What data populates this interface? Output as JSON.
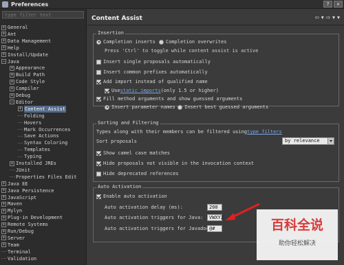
{
  "window": {
    "title": "Preferences"
  },
  "filter": {
    "placeholder": "type filter text"
  },
  "tree": [
    {
      "label": "General",
      "expanded": false
    },
    {
      "label": "Ant",
      "expanded": false
    },
    {
      "label": "Data Management",
      "expanded": false
    },
    {
      "label": "Help",
      "expanded": false
    },
    {
      "label": "Install/Update",
      "expanded": false
    },
    {
      "label": "Java",
      "expanded": true
    },
    {
      "label": "Appearance",
      "expanded": false
    },
    {
      "label": "Build Path",
      "expanded": false
    },
    {
      "label": "Code Style",
      "expanded": false
    },
    {
      "label": "Compiler",
      "expanded": false
    },
    {
      "label": "Debug",
      "expanded": false
    },
    {
      "label": "Editor",
      "expanded": true
    },
    {
      "label": "Content Assist",
      "expanded": false,
      "selected": true
    },
    {
      "label": "Folding"
    },
    {
      "label": "Hovers"
    },
    {
      "label": "Mark Occurrences"
    },
    {
      "label": "Save Actions"
    },
    {
      "label": "Syntax Coloring"
    },
    {
      "label": "Templates"
    },
    {
      "label": "Typing"
    },
    {
      "label": "Installed JREs",
      "expanded": false
    },
    {
      "label": "JUnit"
    },
    {
      "label": "Properties Files Edit"
    },
    {
      "label": "Java EE",
      "expanded": false
    },
    {
      "label": "Java Persistence",
      "expanded": false
    },
    {
      "label": "JavaScript",
      "expanded": false
    },
    {
      "label": "Maven",
      "expanded": false
    },
    {
      "label": "Mylyn",
      "expanded": false
    },
    {
      "label": "Plug-in Development",
      "expanded": false
    },
    {
      "label": "Remote Systems",
      "expanded": false
    },
    {
      "label": "Run/Debug",
      "expanded": false
    },
    {
      "label": "Server",
      "expanded": false
    },
    {
      "label": "Team",
      "expanded": false
    },
    {
      "label": "Terminal"
    },
    {
      "label": "Validation"
    }
  ],
  "page": {
    "title": "Content Assist"
  },
  "insertion": {
    "title": "Insertion",
    "completion_inserts": "Completion inserts",
    "completion_overwrites": "Completion overwrites",
    "toggle_hint": "Press 'Ctrl' to toggle while content assist is active",
    "insert_single": "Insert single proposals automatically",
    "insert_common": "Insert common prefixes automatically",
    "add_import": "Add import instead of qualified name",
    "use_static_prefix": "Use ",
    "static_imports_link": "static imports",
    "use_static_suffix": " (only 1.5 or higher)",
    "fill_method": "Fill method arguments and show guessed arguments",
    "insert_param_names": "Insert parameter names",
    "insert_best_guessed": "Insert best guessed arguments"
  },
  "sorting": {
    "title": "Sorting and Filtering",
    "types_text": "Types along with their members can be filtered using ",
    "type_filters_link": "type filters",
    "sort_proposals": "Sort proposals",
    "sort_value": "by relevance",
    "show_camel": "Show camel case matches",
    "hide_not_visible": "Hide proposals not visible in the invocation context",
    "hide_deprecated": "Hide deprecated references"
  },
  "auto": {
    "title": "Auto Activation",
    "enable": "Enable auto activation",
    "delay_label": "Auto activation delay (ms):",
    "delay_value": "200",
    "java_label": "Auto activation triggers for Java:",
    "java_value": "VWXYZ",
    "javadoc_label": "Auto activation triggers for Javadoc:",
    "javadoc_value": "@#"
  },
  "watermark": {
    "top": "百科全说",
    "bottom": "助你轻松解决"
  },
  "colors": {
    "accent_link": "#7aa7e8",
    "selection": "#556b8a",
    "arrow": "#e02020",
    "watermark_red": "#d93a3a"
  }
}
